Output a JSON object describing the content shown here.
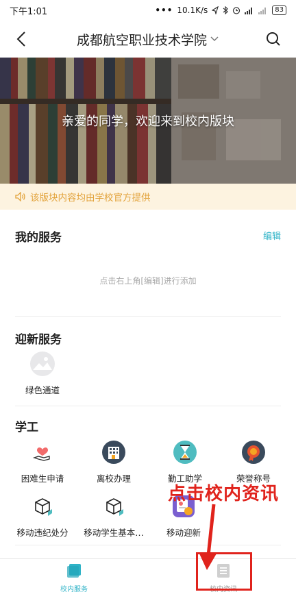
{
  "status_bar": {
    "time": "下午1:01",
    "dots": "•••",
    "network_speed": "10.1K/s",
    "battery": "83"
  },
  "nav": {
    "title": "成都航空职业技术学院"
  },
  "banner": {
    "text": "亲爱的同学，欢迎来到校内版块"
  },
  "notice": {
    "text": "该版块内容均由学校官方提供"
  },
  "my_services": {
    "title": "我的服务",
    "edit_label": "编辑",
    "hint": "点击右上角[编辑]进行添加"
  },
  "welcome_services": {
    "title": "迎新服务",
    "items": [
      {
        "label": "绿色通道",
        "icon": "image-placeholder-icon"
      }
    ]
  },
  "student_affairs": {
    "title": "学工",
    "items": [
      {
        "label": "困难生申请",
        "icon": "heart-hand-icon"
      },
      {
        "label": "离校办理",
        "icon": "building-icon"
      },
      {
        "label": "勤工助学",
        "icon": "hourglass-icon"
      },
      {
        "label": "荣誉称号",
        "icon": "medal-icon"
      },
      {
        "label": "移动违纪处分",
        "icon": "box-icon"
      },
      {
        "label": "移动学生基本…",
        "icon": "box-icon"
      },
      {
        "label": "移动迎新",
        "icon": "welcome-icon"
      }
    ]
  },
  "bottom_nav": {
    "tabs": [
      {
        "label": "校内服务",
        "active": true
      },
      {
        "label": "校内资讯",
        "active": false
      }
    ]
  },
  "annotation": {
    "text": "点击校内资讯",
    "color": "#e0231c"
  },
  "colors": {
    "accent": "#2fb3c7",
    "notice_bg": "#fdf3e0",
    "notice_text": "#e2a23a"
  }
}
